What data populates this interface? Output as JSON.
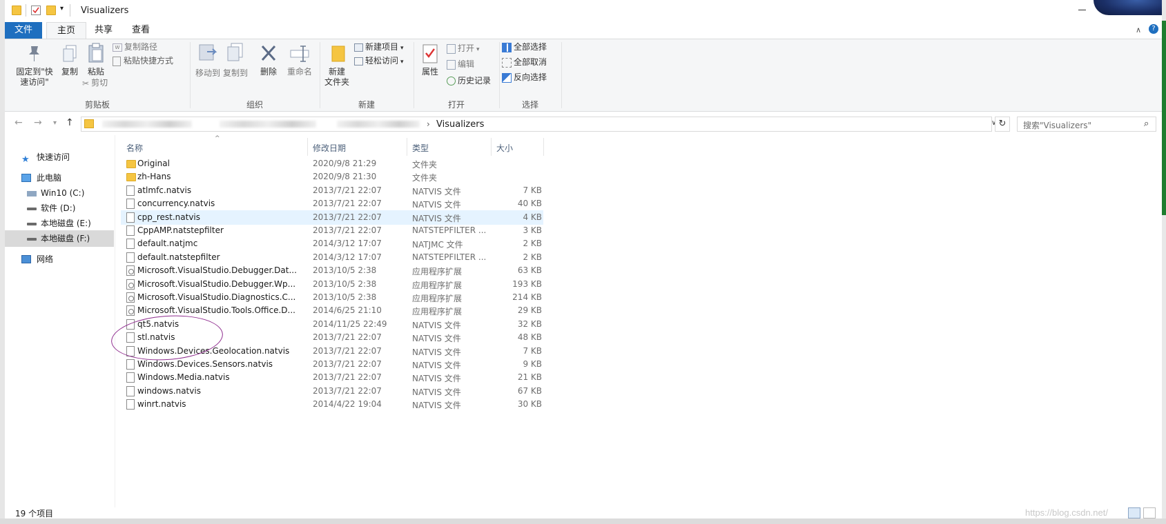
{
  "window": {
    "title": "Visualizers"
  },
  "tabs": {
    "file": "文件",
    "home": "主页",
    "share": "共享",
    "view": "查看"
  },
  "ribbon": {
    "clipboard": {
      "pin": "固定到\"快\n速访问\"",
      "copy": "复制",
      "paste": "粘贴",
      "copy_path": "复制路径",
      "paste_shortcut": "粘贴快捷方式",
      "cut": "剪切",
      "label": "剪贴板"
    },
    "organize": {
      "move_to": "移动到",
      "copy_to": "复制到",
      "delete": "删除",
      "rename": "重命名",
      "label": "组织"
    },
    "new": {
      "new_folder": "新建\n文件夹",
      "new_item": "新建项目",
      "easy_access": "轻松访问",
      "label": "新建"
    },
    "open": {
      "properties": "属性",
      "open": "打开",
      "edit": "编辑",
      "history": "历史记录",
      "label": "打开"
    },
    "select": {
      "select_all": "全部选择",
      "select_none": "全部取消",
      "invert": "反向选择",
      "label": "选择"
    }
  },
  "address": {
    "current": "Visualizers",
    "search_placeholder": "搜索\"Visualizers\""
  },
  "nav": [
    {
      "label": "快速访问"
    },
    {
      "label": "此电脑"
    },
    {
      "label": "Win10 (C:)"
    },
    {
      "label": "软件 (D:)"
    },
    {
      "label": "本地磁盘 (E:)"
    },
    {
      "label": "本地磁盘 (F:)"
    },
    {
      "label": "网络"
    }
  ],
  "columns": {
    "name": "名称",
    "date": "修改日期",
    "type": "类型",
    "size": "大小"
  },
  "files": [
    {
      "name": "Original",
      "date": "2020/9/8 21:29",
      "type": "文件夹",
      "size": "",
      "icon": "folder"
    },
    {
      "name": "zh-Hans",
      "date": "2020/9/8 21:30",
      "type": "文件夹",
      "size": "",
      "icon": "folder"
    },
    {
      "name": "atlmfc.natvis",
      "date": "2013/7/21 22:07",
      "type": "NATVIS 文件",
      "size": "7 KB",
      "icon": "doc"
    },
    {
      "name": "concurrency.natvis",
      "date": "2013/7/21 22:07",
      "type": "NATVIS 文件",
      "size": "40 KB",
      "icon": "doc"
    },
    {
      "name": "cpp_rest.natvis",
      "date": "2013/7/21 22:07",
      "type": "NATVIS 文件",
      "size": "4 KB",
      "icon": "doc"
    },
    {
      "name": "CppAMP.natstepfilter",
      "date": "2013/7/21 22:07",
      "type": "NATSTEPFILTER ...",
      "size": "3 KB",
      "icon": "doc"
    },
    {
      "name": "default.natjmc",
      "date": "2014/3/12 17:07",
      "type": "NATJMC 文件",
      "size": "2 KB",
      "icon": "doc"
    },
    {
      "name": "default.natstepfilter",
      "date": "2014/3/12 17:07",
      "type": "NATSTEPFILTER ...",
      "size": "2 KB",
      "icon": "doc"
    },
    {
      "name": "Microsoft.VisualStudio.Debugger.Dat...",
      "date": "2013/10/5 2:38",
      "type": "应用程序扩展",
      "size": "63 KB",
      "icon": "dll"
    },
    {
      "name": "Microsoft.VisualStudio.Debugger.Wp...",
      "date": "2013/10/5 2:38",
      "type": "应用程序扩展",
      "size": "193 KB",
      "icon": "dll"
    },
    {
      "name": "Microsoft.VisualStudio.Diagnostics.C...",
      "date": "2013/10/5 2:38",
      "type": "应用程序扩展",
      "size": "214 KB",
      "icon": "dll"
    },
    {
      "name": "Microsoft.VisualStudio.Tools.Office.D...",
      "date": "2014/6/25 21:10",
      "type": "应用程序扩展",
      "size": "29 KB",
      "icon": "dll"
    },
    {
      "name": "qt5.natvis",
      "date": "2014/11/25 22:49",
      "type": "NATVIS 文件",
      "size": "32 KB",
      "icon": "doc"
    },
    {
      "name": "stl.natvis",
      "date": "2013/7/21 22:07",
      "type": "NATVIS 文件",
      "size": "48 KB",
      "icon": "doc"
    },
    {
      "name": "Windows.Devices.Geolocation.natvis",
      "date": "2013/7/21 22:07",
      "type": "NATVIS 文件",
      "size": "7 KB",
      "icon": "doc"
    },
    {
      "name": "Windows.Devices.Sensors.natvis",
      "date": "2013/7/21 22:07",
      "type": "NATVIS 文件",
      "size": "9 KB",
      "icon": "doc"
    },
    {
      "name": "Windows.Media.natvis",
      "date": "2013/7/21 22:07",
      "type": "NATVIS 文件",
      "size": "21 KB",
      "icon": "doc"
    },
    {
      "name": "windows.natvis",
      "date": "2013/7/21 22:07",
      "type": "NATVIS 文件",
      "size": "67 KB",
      "icon": "doc"
    },
    {
      "name": "winrt.natvis",
      "date": "2014/4/22 19:04",
      "type": "NATVIS 文件",
      "size": "30 KB",
      "icon": "doc"
    }
  ],
  "status": {
    "count": "19 个项目"
  },
  "watermark": "https://blog.csdn.net/",
  "colors": {
    "accent": "#1f6fbf",
    "annotation": "#8e2b8e",
    "hover_row": "#e5f3ff"
  }
}
